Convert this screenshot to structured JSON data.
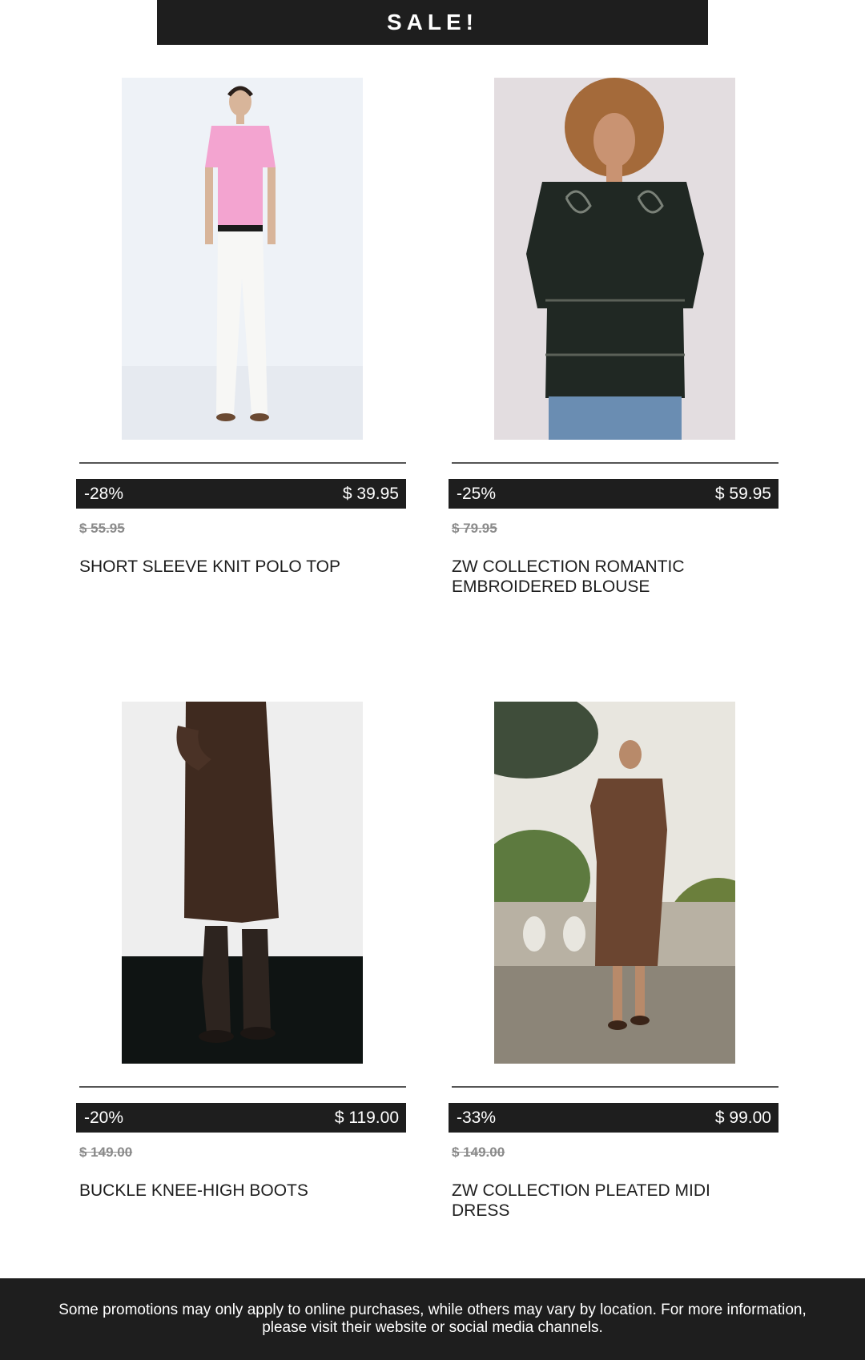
{
  "banner": {
    "title": "SALE!"
  },
  "products": [
    {
      "discount": "-28%",
      "price": "$ 39.95",
      "old_price": "$ 55.95",
      "name": "SHORT SLEEVE KNIT POLO TOP"
    },
    {
      "discount": "-25%",
      "price": "$ 59.95",
      "old_price": "$ 79.95",
      "name": "ZW COLLECTION ROMANTIC EMBROIDERED BLOUSE"
    },
    {
      "discount": "-20%",
      "price": "$ 119.00",
      "old_price": "$ 149.00",
      "name": "BUCKLE KNEE-HIGH BOOTS"
    },
    {
      "discount": "-33%",
      "price": "$ 99.00",
      "old_price": "$ 149.00",
      "name": "ZW COLLECTION PLEATED MIDI DRESS"
    }
  ],
  "footer": {
    "text": "Some promotions may only apply to online purchases, while others may vary by location. For more information, please visit their website or social media channels."
  },
  "colors": {
    "dark": "#1e1e1e",
    "old_price": "#8a8a8a"
  }
}
